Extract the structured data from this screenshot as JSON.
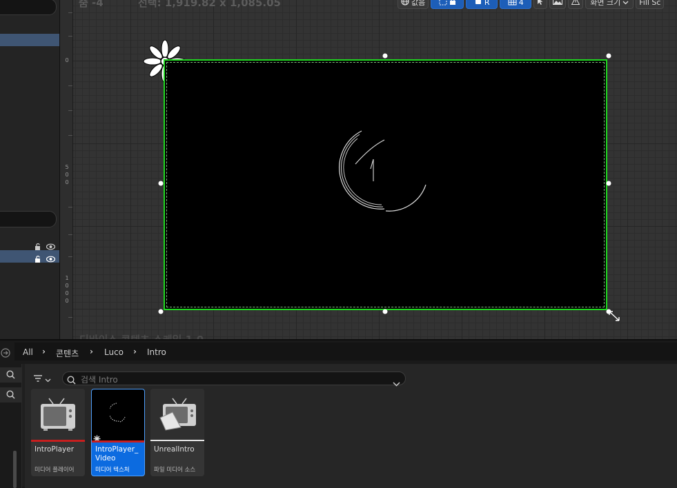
{
  "canvas": {
    "zoom_label": "줌 -4",
    "selection_label": "선택: 1,919.82 x 1,085.05",
    "device_label": "디바이스 콘텐츠 스케일 1.0",
    "ruler_marks": [
      "0",
      "5",
      "0",
      "0",
      "1",
      "0",
      "0",
      "0"
    ]
  },
  "toolbar": {
    "value_label": "값음",
    "r_label": "R",
    "grid_count": "4",
    "screen_size_label": "화면 크기",
    "fill_label": "Fill Sc"
  },
  "breadcrumb": {
    "items": [
      "All",
      "콘텐츠",
      "Luco",
      "Intro"
    ]
  },
  "search": {
    "placeholder": "검색 Intro"
  },
  "assets": [
    {
      "name": "IntroPlayer",
      "type": "미디어 플레이어",
      "color": "#c81e1e"
    },
    {
      "name": "IntroPlayer_ Video",
      "type": "미디어 텍스처",
      "color": "#c81e1e"
    },
    {
      "name": "UnrealIntro",
      "type": "파일 미디어 소스",
      "color": "#e8e8e8"
    }
  ],
  "colors": {
    "selection_green": "#1fd81f",
    "accent_blue": "#0c6be0"
  }
}
